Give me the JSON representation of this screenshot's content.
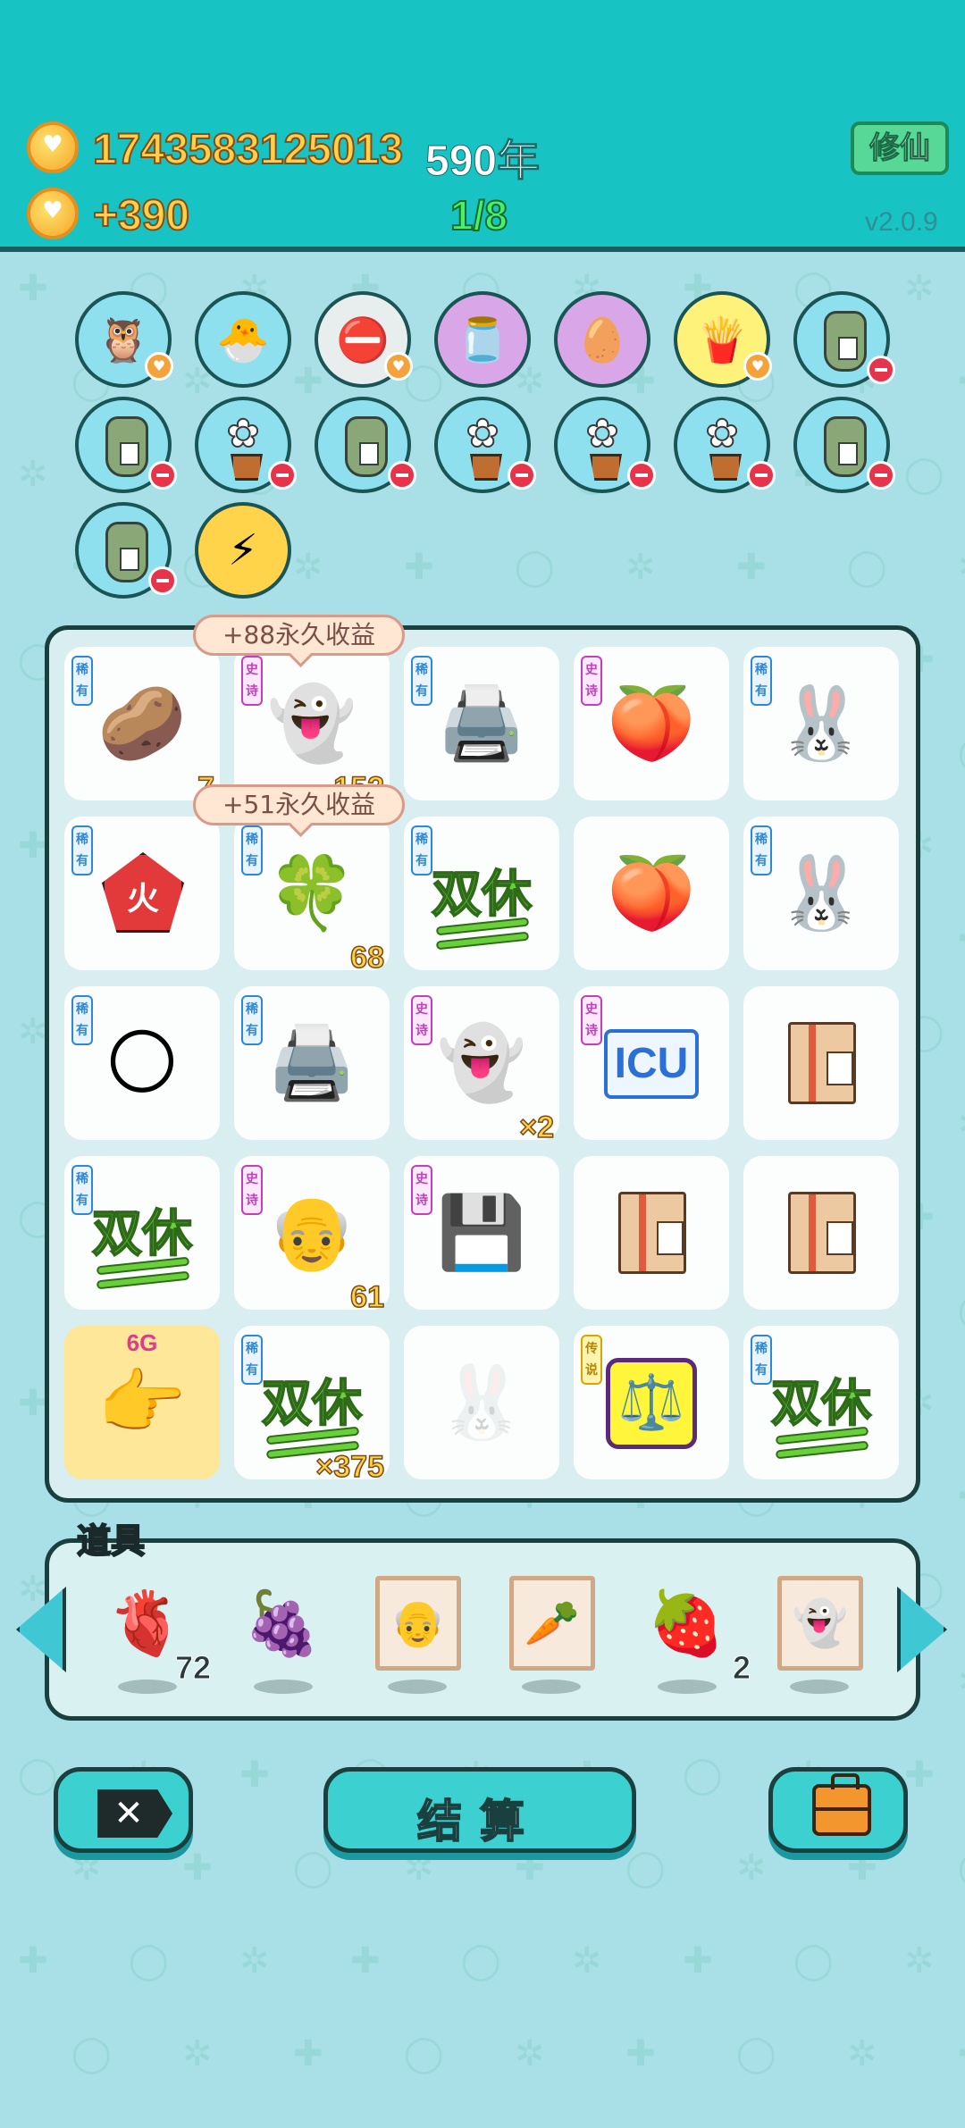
{
  "header": {
    "coins_total": "1743583125013",
    "years": "590年",
    "coins_gain": "+390",
    "progress": "1/8",
    "xiuxian_label": "修仙",
    "version": "v2.0.9"
  },
  "relics": [
    {
      "icon": "owl-sunglasses-icon",
      "glyph": "🦉",
      "bg": "#8fe0ef",
      "badge": "heart"
    },
    {
      "icon": "chick-egg-icon",
      "glyph": "🐣",
      "bg": "#8fe0ef",
      "badge": ""
    },
    {
      "icon": "no-entry-icon",
      "glyph": "⛔",
      "bg": "#e8eeee",
      "badge": "heart"
    },
    {
      "icon": "jar-icon",
      "glyph": "🫙",
      "bg": "#d9a7e8",
      "badge": ""
    },
    {
      "icon": "cracked-egg-icon",
      "glyph": "🥚",
      "bg": "#d9a7e8",
      "badge": ""
    },
    {
      "icon": "fries-icon",
      "glyph": "🍟",
      "bg": "#fff27a",
      "badge": "heart"
    },
    {
      "icon": "sack-icon",
      "glyph": "",
      "bg": "#8fe0ef",
      "badge": "minus"
    },
    {
      "icon": "sack-icon",
      "glyph": "",
      "bg": "#8fe0ef",
      "badge": "minus"
    },
    {
      "icon": "potted-flower-icon",
      "glyph": "",
      "bg": "#8fe0ef",
      "badge": "minus"
    },
    {
      "icon": "sack-icon",
      "glyph": "",
      "bg": "#8fe0ef",
      "badge": "minus"
    },
    {
      "icon": "potted-flower-icon",
      "glyph": "",
      "bg": "#8fe0ef",
      "badge": "minus"
    },
    {
      "icon": "potted-flower-icon",
      "glyph": "",
      "bg": "#8fe0ef",
      "badge": "minus"
    },
    {
      "icon": "potted-flower-icon",
      "glyph": "",
      "bg": "#8fe0ef",
      "badge": "minus"
    },
    {
      "icon": "sack-icon",
      "glyph": "",
      "bg": "#8fe0ef",
      "badge": "minus"
    },
    {
      "icon": "sack-icon",
      "glyph": "",
      "bg": "#8fe0ef",
      "badge": "minus"
    },
    {
      "icon": "lightning-coin-icon",
      "glyph": "⚡",
      "bg": "#ffd34a",
      "badge": ""
    }
  ],
  "tooltips": [
    "+88永久收益",
    "+51永久收益"
  ],
  "board": {
    "tag_rare": "稀有",
    "tag_epic": "史诗",
    "tag_legend": "传说",
    "shuangxiu": "双休",
    "icu": "ICU",
    "fire": "火",
    "cells": [
      {
        "icon": "potato-icon",
        "glyph": "🥔",
        "tag": "rare",
        "count": "7"
      },
      {
        "icon": "ghost-icon",
        "glyph": "👻",
        "tag": "epic",
        "count": "152"
      },
      {
        "icon": "printer-icon",
        "glyph": "🖨️",
        "tag": "rare",
        "count": ""
      },
      {
        "icon": "peach-icon",
        "glyph": "🍑",
        "tag": "epic",
        "count": ""
      },
      {
        "icon": "rabbit-icon",
        "glyph": "🐰",
        "tag": "rare",
        "count": ""
      },
      {
        "icon": "fire-pentagon-icon",
        "glyph": "",
        "tag": "rare",
        "count": ""
      },
      {
        "icon": "clover-pot-icon",
        "glyph": "🍀",
        "tag": "rare",
        "count": "68"
      },
      {
        "icon": "shuangxiu-icon",
        "glyph": "",
        "tag": "rare",
        "count": ""
      },
      {
        "icon": "peach-icon",
        "glyph": "🍑",
        "tag": "",
        "count": ""
      },
      {
        "icon": "rabbit-icon",
        "glyph": "🐰",
        "tag": "rare",
        "count": ""
      },
      {
        "icon": "capsule-ball-icon",
        "glyph": "🌕",
        "tag": "rare",
        "count": ""
      },
      {
        "icon": "printer-icon",
        "glyph": "🖨️",
        "tag": "rare",
        "count": ""
      },
      {
        "icon": "black-white-impermanence-icon",
        "glyph": "👻",
        "tag": "epic",
        "count": "×2"
      },
      {
        "icon": "icu-icon",
        "glyph": "",
        "tag": "epic",
        "count": ""
      },
      {
        "icon": "package-box-icon",
        "glyph": "",
        "tag": "",
        "count": ""
      },
      {
        "icon": "shuangxiu-icon",
        "glyph": "",
        "tag": "rare",
        "count": ""
      },
      {
        "icon": "old-man-icon",
        "glyph": "👴",
        "tag": "epic",
        "count": "61"
      },
      {
        "icon": "graphics-card-icon",
        "glyph": "💾",
        "tag": "epic",
        "count": ""
      },
      {
        "icon": "package-box-icon",
        "glyph": "",
        "tag": "",
        "count": ""
      },
      {
        "icon": "package-box-icon",
        "glyph": "",
        "tag": "",
        "count": ""
      },
      {
        "icon": "6g-hand-icon",
        "glyph": "👉",
        "tag": "",
        "count": "",
        "label": "6G"
      },
      {
        "icon": "shuangxiu-icon",
        "glyph": "",
        "tag": "rare",
        "count": "×375"
      },
      {
        "icon": "faded-rabbit-icon",
        "glyph": "🐰",
        "tag": "",
        "count": ""
      },
      {
        "icon": "scale-icon",
        "glyph": "⚖️",
        "tag": "legend",
        "count": ""
      },
      {
        "icon": "shuangxiu-icon",
        "glyph": "",
        "tag": "rare",
        "count": ""
      }
    ]
  },
  "props": {
    "title": "道具",
    "items": [
      {
        "icon": "liver-icon",
        "glyph": "🫀",
        "count": "72",
        "framed": false
      },
      {
        "icon": "bayberry-icon",
        "glyph": "🍇",
        "count": "",
        "framed": false
      },
      {
        "icon": "old-man-portrait-icon",
        "glyph": "👴",
        "count": "",
        "framed": true
      },
      {
        "icon": "carrot-portrait-icon",
        "glyph": "🥕",
        "count": "",
        "framed": true
      },
      {
        "icon": "strawberry-icon",
        "glyph": "🍓",
        "count": "2",
        "framed": false
      },
      {
        "icon": "impermanence-portrait-icon",
        "glyph": "👻",
        "count": "",
        "framed": true
      }
    ]
  },
  "actions": {
    "settle_label": "结算"
  }
}
